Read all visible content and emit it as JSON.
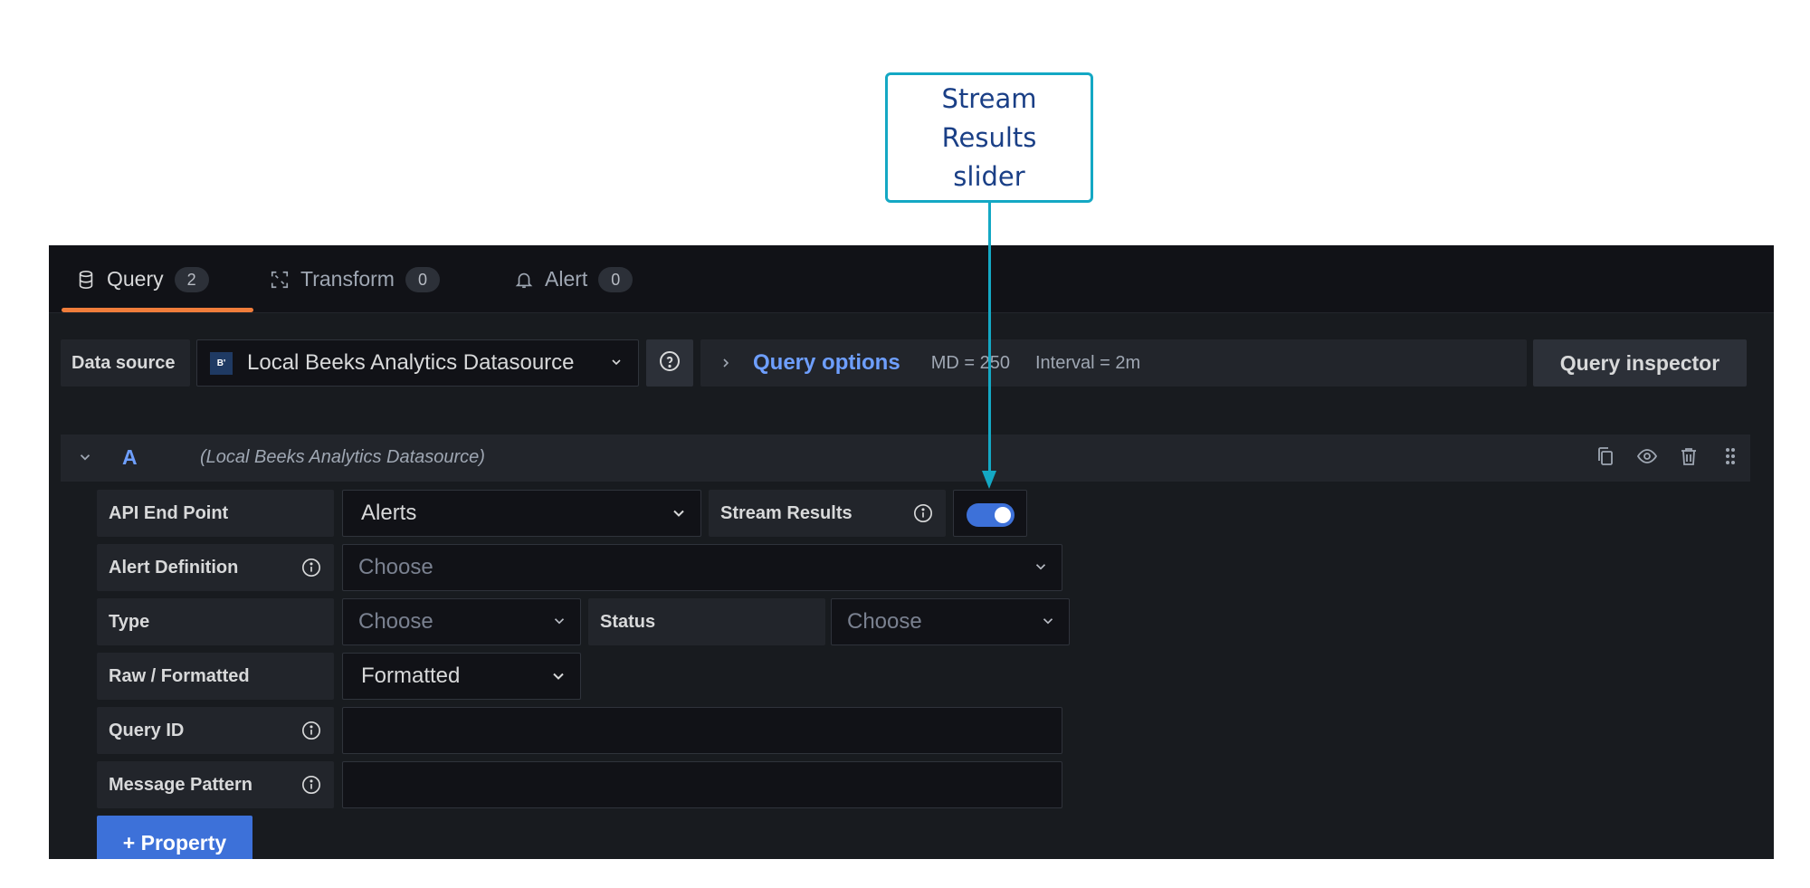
{
  "annotation": {
    "text_line1": "Stream Results",
    "text_line2": "slider"
  },
  "tabs": [
    {
      "label": "Query",
      "count": "2",
      "icon": "database-icon"
    },
    {
      "label": "Transform",
      "count": "0",
      "icon": "transform-icon"
    },
    {
      "label": "Alert",
      "count": "0",
      "icon": "bell-icon"
    }
  ],
  "toolbar": {
    "data_source_label": "Data source",
    "data_source_value": "Local Beeks Analytics Datasource",
    "data_source_logo": "B'",
    "query_options_label": "Query options",
    "md": "MD = 250",
    "interval": "Interval = 2m",
    "query_inspector_label": "Query inspector"
  },
  "query": {
    "name": "A",
    "datasource": "(Local Beeks Analytics Datasource)",
    "api_end_point_label": "API End Point",
    "api_end_point_value": "Alerts",
    "stream_results_label": "Stream Results",
    "stream_results_on": true,
    "alert_definition_label": "Alert Definition",
    "alert_definition_placeholder": "Choose",
    "type_label": "Type",
    "type_placeholder": "Choose",
    "status_label": "Status",
    "status_placeholder": "Choose",
    "raw_formatted_label": "Raw / Formatted",
    "raw_formatted_value": "Formatted",
    "query_id_label": "Query ID",
    "query_id_value": "",
    "message_pattern_label": "Message Pattern",
    "message_pattern_value": "",
    "add_property_label": "+ Property"
  },
  "colors": {
    "accent": "#3d71d9",
    "tab_underline": "#f07d3b",
    "callout": "#14a8c4",
    "link": "#6e9fff"
  }
}
